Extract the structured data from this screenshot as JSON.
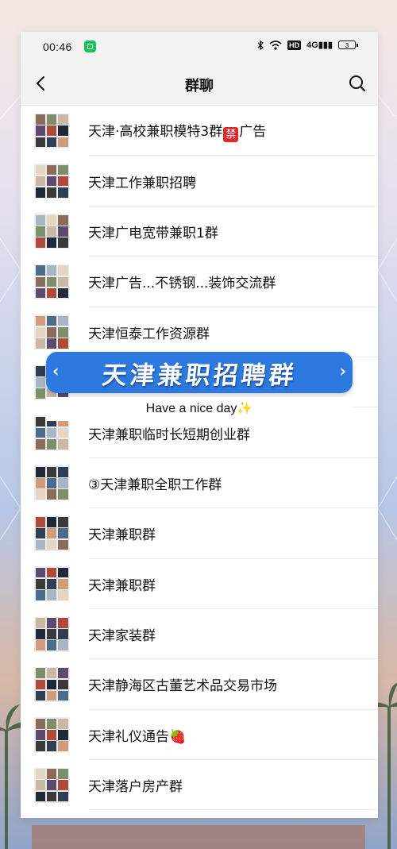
{
  "status_bar": {
    "time": "00:46",
    "hd": "HD",
    "signal": "4G",
    "battery": "3"
  },
  "nav": {
    "title": "群聊"
  },
  "groups": [
    {
      "name_pre": "天津·高校兼职模特3群",
      "badge": "禁",
      "name_post": "广告"
    },
    {
      "name": "天津工作兼职招聘"
    },
    {
      "name": "天津广电宽带兼职1群"
    },
    {
      "name": "天津广告...不锈钢...装饰交流群"
    },
    {
      "name": "天津恒泰工作资源群"
    },
    {
      "name": ""
    },
    {
      "name": "天津兼职临时长短期创业群"
    },
    {
      "name": "③天津兼职全职工作群"
    },
    {
      "name": "天津兼职群"
    },
    {
      "name": "天津兼职群"
    },
    {
      "name": "天津家装群"
    },
    {
      "name": "天津静海区古董艺术品交易市场"
    },
    {
      "name": "天津礼仪通告🍓"
    },
    {
      "name": "天津落户房产群"
    }
  ],
  "banner": {
    "title": "天津兼职招聘群",
    "left_arrow": "‹",
    "right_arrow": "›",
    "subtitle": "Have a nice day",
    "sparkle": "✨"
  },
  "colors": {
    "banner": "#2d79e0",
    "ban_badge": "#e0282b",
    "app_badge": "#16c25a"
  }
}
